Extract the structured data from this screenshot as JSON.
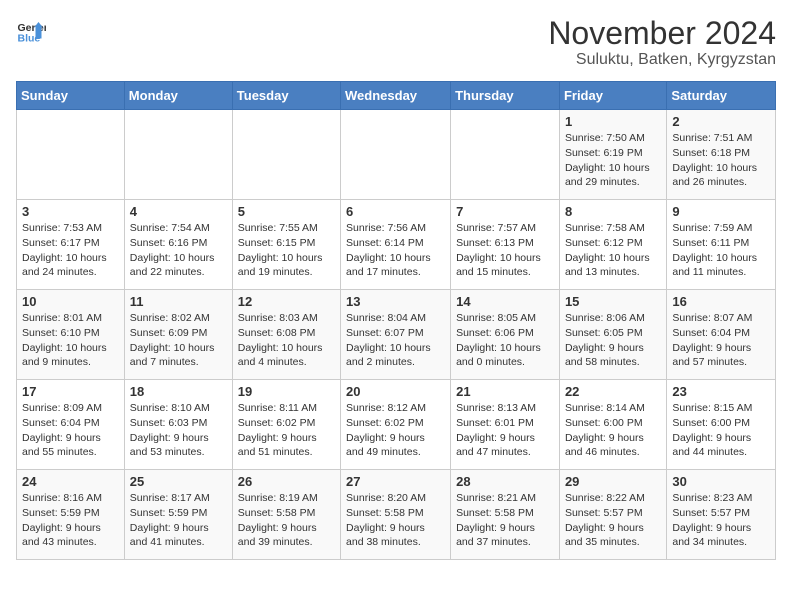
{
  "logo": {
    "general": "General",
    "blue": "Blue"
  },
  "title": {
    "month": "November 2024",
    "location": "Suluktu, Batken, Kyrgyzstan"
  },
  "headers": [
    "Sunday",
    "Monday",
    "Tuesday",
    "Wednesday",
    "Thursday",
    "Friday",
    "Saturday"
  ],
  "weeks": [
    [
      {
        "day": "",
        "sunrise": "",
        "sunset": "",
        "daylight": ""
      },
      {
        "day": "",
        "sunrise": "",
        "sunset": "",
        "daylight": ""
      },
      {
        "day": "",
        "sunrise": "",
        "sunset": "",
        "daylight": ""
      },
      {
        "day": "",
        "sunrise": "",
        "sunset": "",
        "daylight": ""
      },
      {
        "day": "",
        "sunrise": "",
        "sunset": "",
        "daylight": ""
      },
      {
        "day": "1",
        "sunrise": "Sunrise: 7:50 AM",
        "sunset": "Sunset: 6:19 PM",
        "daylight": "Daylight: 10 hours and 29 minutes."
      },
      {
        "day": "2",
        "sunrise": "Sunrise: 7:51 AM",
        "sunset": "Sunset: 6:18 PM",
        "daylight": "Daylight: 10 hours and 26 minutes."
      }
    ],
    [
      {
        "day": "3",
        "sunrise": "Sunrise: 7:53 AM",
        "sunset": "Sunset: 6:17 PM",
        "daylight": "Daylight: 10 hours and 24 minutes."
      },
      {
        "day": "4",
        "sunrise": "Sunrise: 7:54 AM",
        "sunset": "Sunset: 6:16 PM",
        "daylight": "Daylight: 10 hours and 22 minutes."
      },
      {
        "day": "5",
        "sunrise": "Sunrise: 7:55 AM",
        "sunset": "Sunset: 6:15 PM",
        "daylight": "Daylight: 10 hours and 19 minutes."
      },
      {
        "day": "6",
        "sunrise": "Sunrise: 7:56 AM",
        "sunset": "Sunset: 6:14 PM",
        "daylight": "Daylight: 10 hours and 17 minutes."
      },
      {
        "day": "7",
        "sunrise": "Sunrise: 7:57 AM",
        "sunset": "Sunset: 6:13 PM",
        "daylight": "Daylight: 10 hours and 15 minutes."
      },
      {
        "day": "8",
        "sunrise": "Sunrise: 7:58 AM",
        "sunset": "Sunset: 6:12 PM",
        "daylight": "Daylight: 10 hours and 13 minutes."
      },
      {
        "day": "9",
        "sunrise": "Sunrise: 7:59 AM",
        "sunset": "Sunset: 6:11 PM",
        "daylight": "Daylight: 10 hours and 11 minutes."
      }
    ],
    [
      {
        "day": "10",
        "sunrise": "Sunrise: 8:01 AM",
        "sunset": "Sunset: 6:10 PM",
        "daylight": "Daylight: 10 hours and 9 minutes."
      },
      {
        "day": "11",
        "sunrise": "Sunrise: 8:02 AM",
        "sunset": "Sunset: 6:09 PM",
        "daylight": "Daylight: 10 hours and 7 minutes."
      },
      {
        "day": "12",
        "sunrise": "Sunrise: 8:03 AM",
        "sunset": "Sunset: 6:08 PM",
        "daylight": "Daylight: 10 hours and 4 minutes."
      },
      {
        "day": "13",
        "sunrise": "Sunrise: 8:04 AM",
        "sunset": "Sunset: 6:07 PM",
        "daylight": "Daylight: 10 hours and 2 minutes."
      },
      {
        "day": "14",
        "sunrise": "Sunrise: 8:05 AM",
        "sunset": "Sunset: 6:06 PM",
        "daylight": "Daylight: 10 hours and 0 minutes."
      },
      {
        "day": "15",
        "sunrise": "Sunrise: 8:06 AM",
        "sunset": "Sunset: 6:05 PM",
        "daylight": "Daylight: 9 hours and 58 minutes."
      },
      {
        "day": "16",
        "sunrise": "Sunrise: 8:07 AM",
        "sunset": "Sunset: 6:04 PM",
        "daylight": "Daylight: 9 hours and 57 minutes."
      }
    ],
    [
      {
        "day": "17",
        "sunrise": "Sunrise: 8:09 AM",
        "sunset": "Sunset: 6:04 PM",
        "daylight": "Daylight: 9 hours and 55 minutes."
      },
      {
        "day": "18",
        "sunrise": "Sunrise: 8:10 AM",
        "sunset": "Sunset: 6:03 PM",
        "daylight": "Daylight: 9 hours and 53 minutes."
      },
      {
        "day": "19",
        "sunrise": "Sunrise: 8:11 AM",
        "sunset": "Sunset: 6:02 PM",
        "daylight": "Daylight: 9 hours and 51 minutes."
      },
      {
        "day": "20",
        "sunrise": "Sunrise: 8:12 AM",
        "sunset": "Sunset: 6:02 PM",
        "daylight": "Daylight: 9 hours and 49 minutes."
      },
      {
        "day": "21",
        "sunrise": "Sunrise: 8:13 AM",
        "sunset": "Sunset: 6:01 PM",
        "daylight": "Daylight: 9 hours and 47 minutes."
      },
      {
        "day": "22",
        "sunrise": "Sunrise: 8:14 AM",
        "sunset": "Sunset: 6:00 PM",
        "daylight": "Daylight: 9 hours and 46 minutes."
      },
      {
        "day": "23",
        "sunrise": "Sunrise: 8:15 AM",
        "sunset": "Sunset: 6:00 PM",
        "daylight": "Daylight: 9 hours and 44 minutes."
      }
    ],
    [
      {
        "day": "24",
        "sunrise": "Sunrise: 8:16 AM",
        "sunset": "Sunset: 5:59 PM",
        "daylight": "Daylight: 9 hours and 43 minutes."
      },
      {
        "day": "25",
        "sunrise": "Sunrise: 8:17 AM",
        "sunset": "Sunset: 5:59 PM",
        "daylight": "Daylight: 9 hours and 41 minutes."
      },
      {
        "day": "26",
        "sunrise": "Sunrise: 8:19 AM",
        "sunset": "Sunset: 5:58 PM",
        "daylight": "Daylight: 9 hours and 39 minutes."
      },
      {
        "day": "27",
        "sunrise": "Sunrise: 8:20 AM",
        "sunset": "Sunset: 5:58 PM",
        "daylight": "Daylight: 9 hours and 38 minutes."
      },
      {
        "day": "28",
        "sunrise": "Sunrise: 8:21 AM",
        "sunset": "Sunset: 5:58 PM",
        "daylight": "Daylight: 9 hours and 37 minutes."
      },
      {
        "day": "29",
        "sunrise": "Sunrise: 8:22 AM",
        "sunset": "Sunset: 5:57 PM",
        "daylight": "Daylight: 9 hours and 35 minutes."
      },
      {
        "day": "30",
        "sunrise": "Sunrise: 8:23 AM",
        "sunset": "Sunset: 5:57 PM",
        "daylight": "Daylight: 9 hours and 34 minutes."
      }
    ]
  ]
}
